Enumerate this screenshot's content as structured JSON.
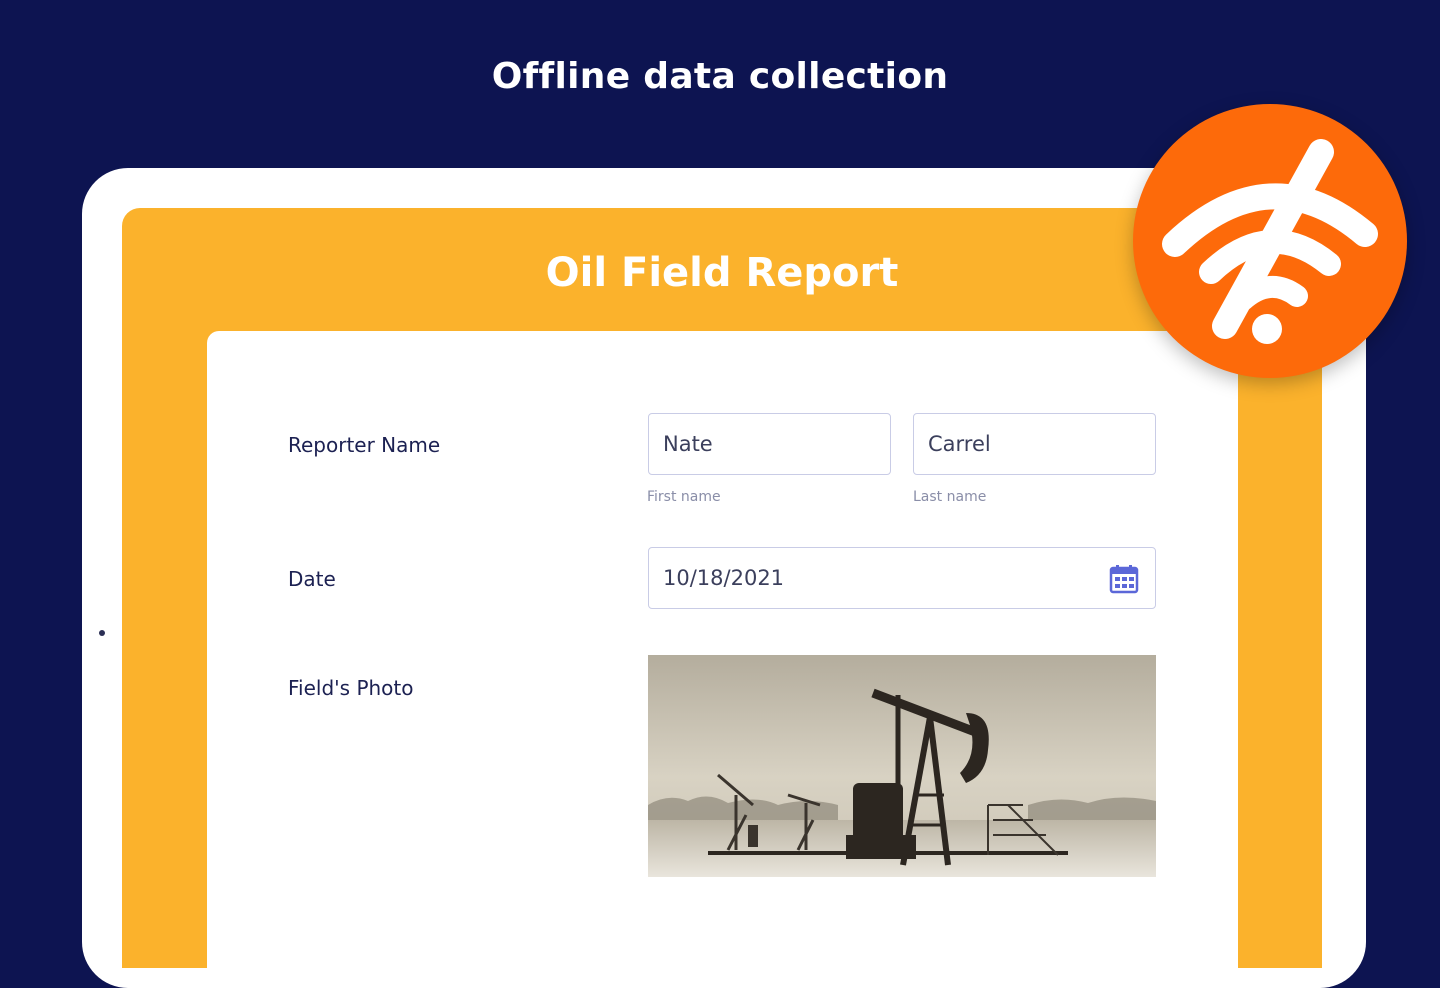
{
  "headline": "Offline data collection",
  "form": {
    "title": "Oil Field Report",
    "reporter": {
      "label": "Reporter Name",
      "first_value": "Nate",
      "first_sublabel": "First name",
      "last_value": "Carrel",
      "last_sublabel": "Last name"
    },
    "date": {
      "label": "Date",
      "value": "10/18/2021",
      "icon": "calendar-icon"
    },
    "photo": {
      "label": "Field's Photo",
      "content": "oil-pumpjack-photo"
    }
  },
  "badge": {
    "icon": "wifi-off-icon"
  },
  "colors": {
    "background": "#0d1451",
    "form_header": "#fbb22c",
    "badge": "#fd6a0a",
    "accent_blue": "#5b67d8"
  }
}
